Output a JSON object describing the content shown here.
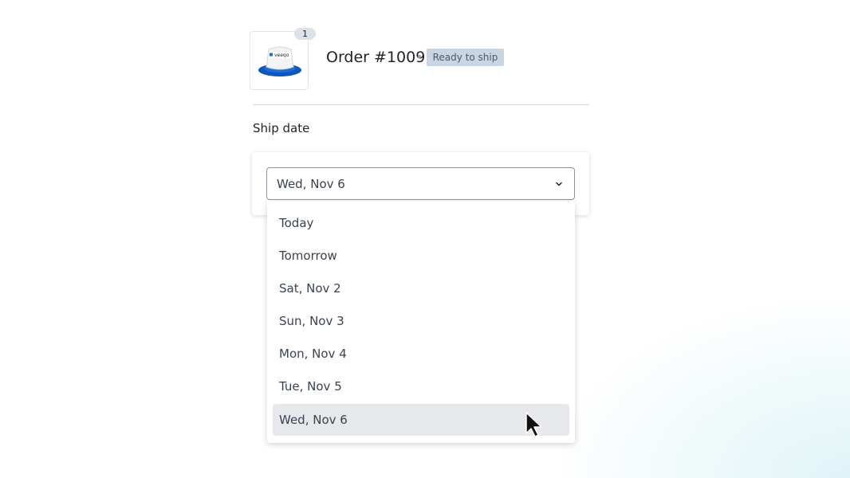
{
  "product": {
    "thumbnail_icon": "bucket-hat-product-image",
    "logo_text": "veeqo",
    "quantity": "1"
  },
  "order": {
    "title": "Order #1009",
    "status": "Ready to ship",
    "status_color": "#c8d6e4"
  },
  "ship_date": {
    "label": "Ship date",
    "selected": "Wed, Nov 6",
    "chevron_icon": "chevron-down-icon",
    "options": [
      "Today",
      "Tomorrow",
      "Sat, Nov 2",
      "Sun, Nov 3",
      "Mon, Nov 4",
      "Tue, Nov 5",
      "Wed, Nov 6"
    ]
  }
}
